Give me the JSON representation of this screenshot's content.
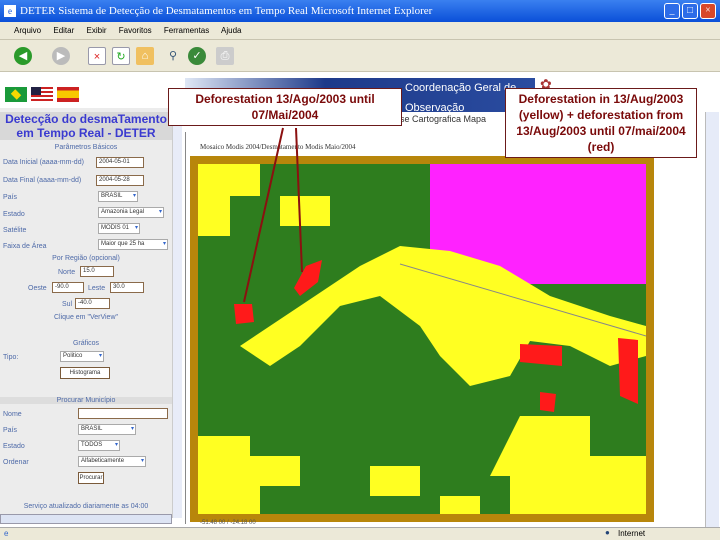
{
  "window": {
    "title": "DETER   Sistema de Detecção de Desmatamentos em Tempo Real   Microsoft Internet Explorer",
    "app_icon": "ie-icon"
  },
  "menu": [
    "Arquivo",
    "Editar",
    "Exibir",
    "Favoritos",
    "Ferramentas",
    "Ajuda"
  ],
  "toolbar": {
    "icons": [
      "back-icon",
      "forward-icon",
      "stop-icon",
      "refresh-icon",
      "home-icon",
      "search-icon",
      "favorites-icon",
      "print-icon"
    ]
  },
  "banner": {
    "text": "Coordenação Geral de Observação"
  },
  "tabs_text": "se Cartografica  Mapa",
  "left": {
    "title": "Detecção do desmaTamento em Tempo Real - DETER",
    "basic_header": "Parâmetros Básicos",
    "data_inicial_label": "Data Inicial (aaaa-mm-dd)",
    "data_inicial": "2004-05-01",
    "data_final_label": "Data Final (aaaa-mm-dd)",
    "data_final": "2004-05-28",
    "pais_label": "País",
    "pais": "BRASIL",
    "estado_label": "Estado",
    "estado": "Amazonia Legal",
    "satelite_label": "Satélite",
    "satelite": "MODIS 01",
    "faixa_label": "Faixa de Área",
    "faixa": "Maior que 25 ha",
    "region_header": "Por Região (opcional)",
    "norte_label": "Norte",
    "norte": "15.0",
    "oeste_label": "Oeste",
    "oeste": "-90.0",
    "leste_label": "Leste",
    "leste": "30.0",
    "sul_label": "Sul",
    "sul": "-40.0",
    "click_hint": "Clique em \"VerView\"",
    "graficos_header": "Gráficos",
    "tipo_label": "Tipo:",
    "tipo": "Politico",
    "histograma_button": "Histograma",
    "municipio_header": "Procurar Município",
    "nome_label": "Nome",
    "nome": "",
    "m_pais_label": "País",
    "m_pais": "BRASIL",
    "m_estado_label": "Estado",
    "m_estado": "TODOS",
    "ordenar_label": "Ordenar",
    "ordenar": "Alfabeticamente",
    "procurar_button": "Procurar",
    "footer": "Serviço atualizado diariamente as 04:00"
  },
  "map": {
    "caption": "Mosaico Modis 2004/Desmatamento Modis Maio/2004",
    "coords": "-51.48 00 / -24.18 00"
  },
  "callouts": {
    "left": "Deforestation 13/Ago/2003 until 07/Mai/2004",
    "right": "Deforestation in 13/Aug/2003 (yellow) + deforestation from 13/Aug/2003 until 07/mai/2004 (red)"
  },
  "status": {
    "zone": "Internet"
  },
  "colors": {
    "forest": "#2e7d1e",
    "deforest_old": "#ffff22",
    "deforest_new": "#ff1a1a",
    "nonforest": "#ff22ff",
    "frame": "#b8860b"
  }
}
